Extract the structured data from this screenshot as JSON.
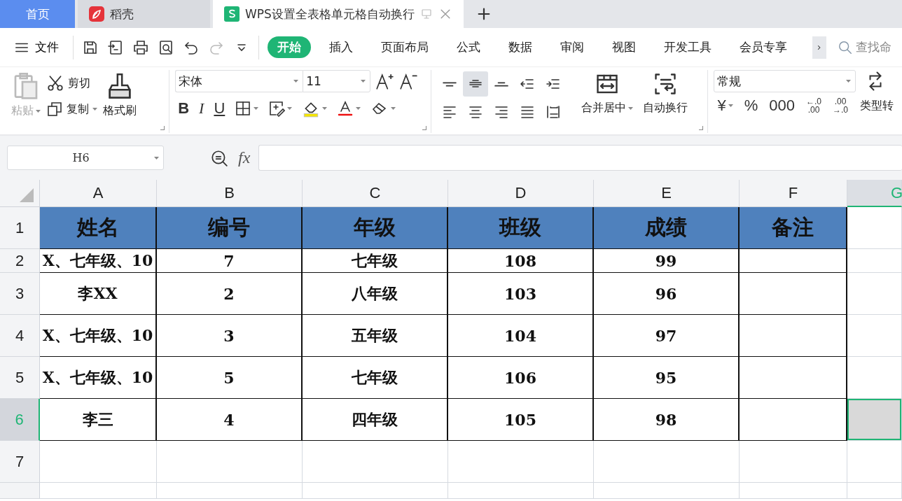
{
  "tabs": [
    {
      "label": "首页",
      "kind": "home",
      "selected": false
    },
    {
      "label": "稻壳",
      "kind": "docer",
      "selected": false
    },
    {
      "label": "WPS设置全表格单元格自动换行",
      "kind": "sheet",
      "selected": true
    }
  ],
  "menu": {
    "file": "文件",
    "tabs": [
      {
        "label": "开始",
        "selected": true
      },
      {
        "label": "插入",
        "selected": false
      },
      {
        "label": "页面布局",
        "selected": false
      },
      {
        "label": "公式",
        "selected": false
      },
      {
        "label": "数据",
        "selected": false
      },
      {
        "label": "审阅",
        "selected": false
      },
      {
        "label": "视图",
        "selected": false
      },
      {
        "label": "开发工具",
        "selected": false
      },
      {
        "label": "会员专享",
        "selected": false
      }
    ],
    "search": "查找命"
  },
  "ribbon": {
    "paste": "粘贴",
    "cut": "剪切",
    "copy": "复制",
    "format_painter": "格式刷",
    "font": "宋体",
    "font_size": "11",
    "format_buttons": [
      {
        "kind": "bold",
        "label": "B"
      },
      {
        "kind": "italic",
        "label": "I"
      },
      {
        "kind": "underline",
        "label": "U"
      }
    ],
    "align": [
      {
        "kind": "top",
        "selected": false
      },
      {
        "kind": "middle",
        "selected": true
      },
      {
        "kind": "bottom",
        "selected": false
      },
      {
        "kind": "outdent",
        "selected": false
      },
      {
        "kind": "indent",
        "selected": false
      },
      {
        "kind": "left",
        "selected": false
      },
      {
        "kind": "center",
        "selected": false
      },
      {
        "kind": "right",
        "selected": false
      },
      {
        "kind": "justify",
        "selected": false
      },
      {
        "kind": "distributed",
        "selected": false
      }
    ],
    "merge": "合并居中",
    "wrap": "自动换行",
    "number_format": "常规",
    "number_buttons": [
      {
        "kind": "currency",
        "lines": [
          "¥"
        ]
      },
      {
        "kind": "percent",
        "lines": [
          "%"
        ]
      },
      {
        "kind": "thousands",
        "lines": [
          "000"
        ]
      },
      {
        "kind": "inc_decimal",
        "lines": [
          "←.0",
          ".00"
        ]
      },
      {
        "kind": "dec_decimal",
        "lines": [
          ".00",
          "→.0"
        ]
      }
    ],
    "convert": "类型转"
  },
  "name_box": "H6",
  "fx": "fx",
  "columns": [
    {
      "label": "A",
      "selected": false
    },
    {
      "label": "B",
      "selected": false
    },
    {
      "label": "C",
      "selected": false
    },
    {
      "label": "D",
      "selected": false
    },
    {
      "label": "E",
      "selected": false
    },
    {
      "label": "F",
      "selected": false
    },
    {
      "label": "G",
      "selected": true
    }
  ],
  "rows": [
    {
      "label": "1",
      "kind": "header",
      "selected": false,
      "cells": [
        "姓名",
        "编号",
        "年级",
        "班级",
        "成绩",
        "备注"
      ]
    },
    {
      "label": "2",
      "kind": "data",
      "selected": false,
      "cells": [
        "X、七年级、10",
        "7",
        "七年级",
        "108",
        "99"
      ]
    },
    {
      "label": "3",
      "kind": "data",
      "selected": false,
      "cells": [
        "李XX",
        "2",
        "八年级",
        "103",
        "96"
      ]
    },
    {
      "label": "4",
      "kind": "data",
      "selected": false,
      "cells": [
        "X、七年级、10",
        "3",
        "五年级",
        "104",
        "97"
      ]
    },
    {
      "label": "5",
      "kind": "data",
      "selected": false,
      "cells": [
        "X、七年级、10",
        "5",
        "七年级",
        "106",
        "95"
      ]
    },
    {
      "label": "6",
      "kind": "data",
      "selected": true,
      "cells": [
        "李三",
        "4",
        "四年级",
        "105",
        "98"
      ]
    },
    {
      "label": "7",
      "kind": "empty",
      "selected": false,
      "cells": []
    }
  ]
}
